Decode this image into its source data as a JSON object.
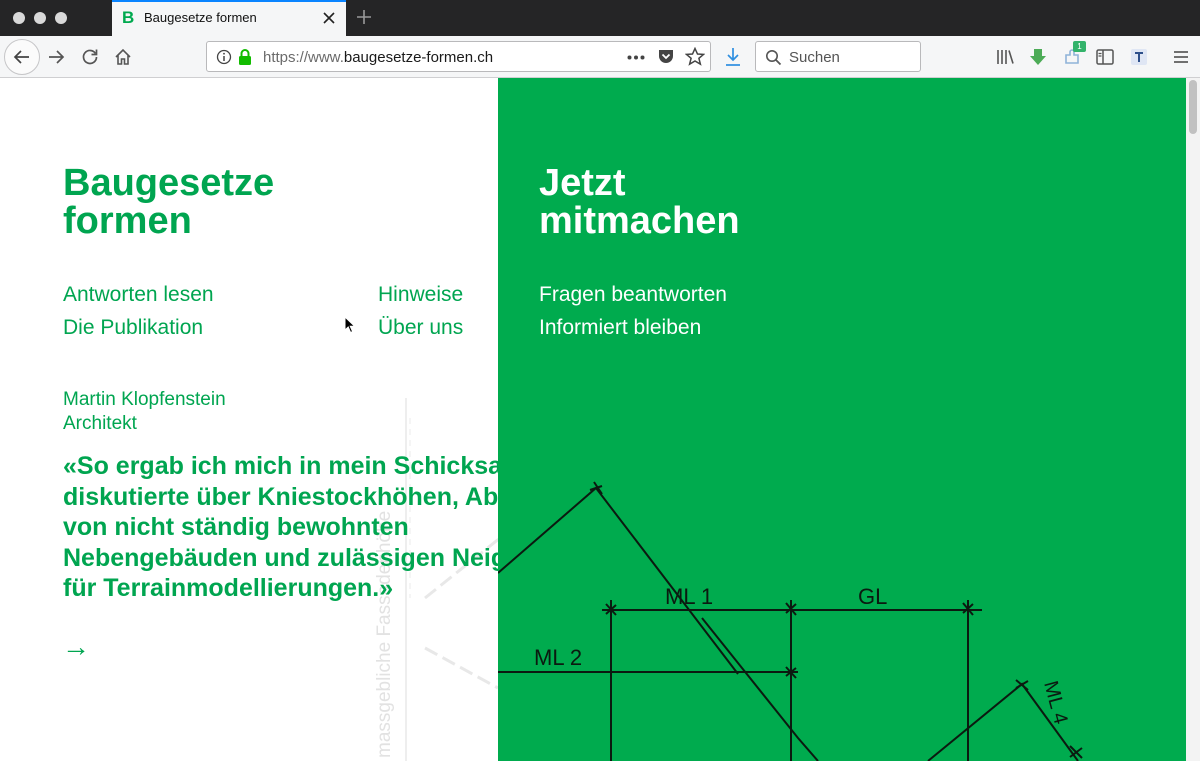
{
  "browser": {
    "tab": {
      "favicon": "B",
      "title": "Baugesetze formen"
    },
    "url": {
      "prefix": "https://www.",
      "host": "baugesetze-formen.ch"
    },
    "search_placeholder": "Suchen",
    "extension_badge": "1"
  },
  "left": {
    "title": "Baugesetze\nformen",
    "nav": {
      "antworten": "Antworten lesen",
      "publikation": "Die Publikation",
      "hinweise": "Hinweise",
      "ueber": "Über uns"
    },
    "person": {
      "name": "Martin Klopfenstein",
      "role": "Architekt"
    },
    "quote": "«So ergab ich mich in mein Schicksal und diskutierte über Kniestockhöhen, Abstände von nicht ständig bewohnten Nebengebäuden und zulässigen Neigungen für Terrainmodellierungen.»",
    "arrow": "→",
    "drawing_faint_text": "massgebliche Fassadenhöhe"
  },
  "right": {
    "title": "Jetzt\nmitmachen",
    "nav": {
      "fragen": "Fragen beantworten",
      "informiert": "Informiert bleiben"
    },
    "plan_labels": {
      "ml1": "ML 1",
      "gl": "GL",
      "ml2": "ML 2",
      "ml4": "ML 4"
    }
  },
  "colors": {
    "brand_green": "#00a550",
    "panel_green": "#00ab4e",
    "tab_accent": "#0a84ff"
  }
}
